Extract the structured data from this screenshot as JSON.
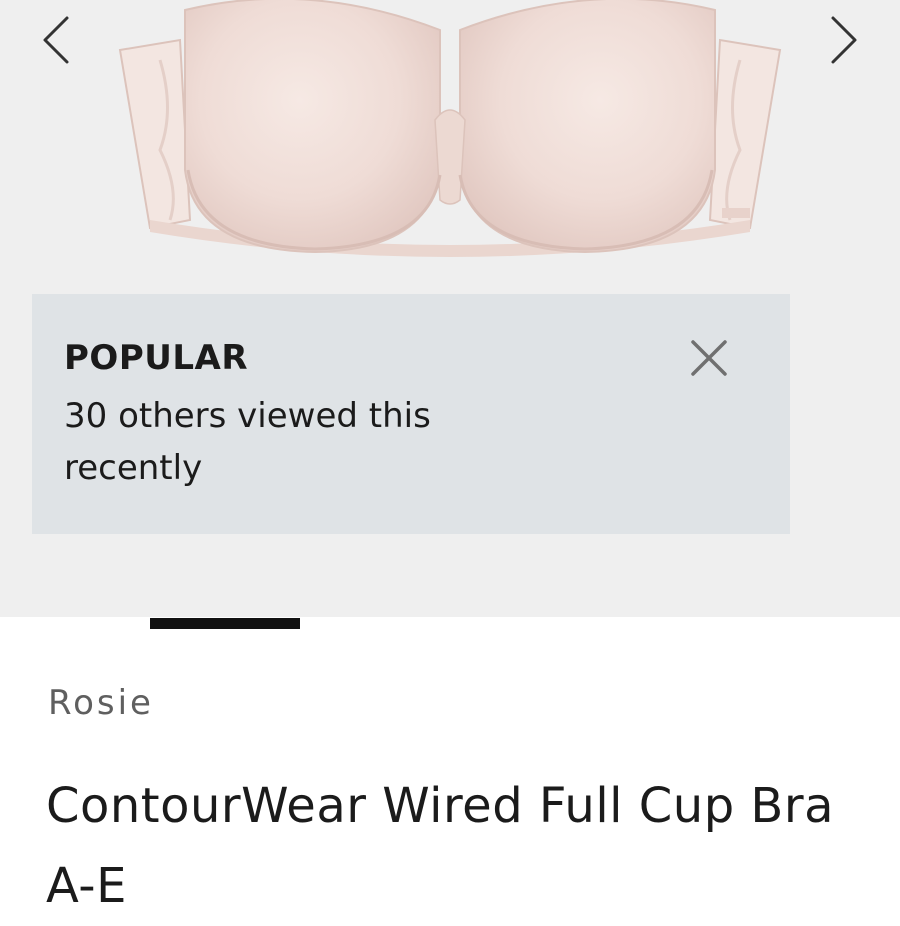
{
  "gallery": {
    "image_alt": "Rosie ContourWear Wired Full Cup Bra in blush pink",
    "prev_icon": "chevron-left-icon",
    "next_icon": "chevron-right-icon"
  },
  "popup": {
    "title": "POPULAR",
    "text": "30 others viewed this recently",
    "close_icon": "close-icon"
  },
  "product": {
    "brand": "Rosie",
    "title": "ContourWear Wired Full Cup Bra A-E"
  },
  "colors": {
    "gallery_bg": "#efefef",
    "popup_bg": "#dfe3e6",
    "text": "#1b1b1b",
    "brand_text": "#5f5f5f",
    "product_blush": "#f1dfd9"
  }
}
